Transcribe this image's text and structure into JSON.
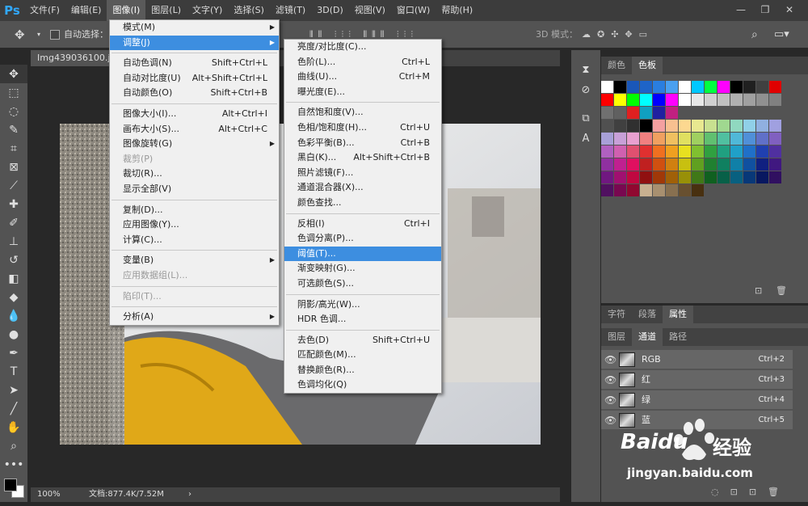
{
  "app": {
    "logo": "Ps"
  },
  "menubar": {
    "items": [
      "文件(F)",
      "编辑(E)",
      "图像(I)",
      "图层(L)",
      "文字(Y)",
      "选择(S)",
      "滤镜(T)",
      "3D(D)",
      "视图(V)",
      "窗口(W)",
      "帮助(H)"
    ],
    "active_index": 2,
    "window_buttons": [
      "—",
      "❐",
      "✕"
    ]
  },
  "options_bar": {
    "auto_select_label": "自动选择：",
    "mode3d_label": "3D 模式："
  },
  "document": {
    "tab_name": "Img439036100.jp",
    "zoom": "100%",
    "doc_info": "文档:877.4K/7.52M"
  },
  "image_menu": {
    "items": [
      {
        "label": "模式(M)",
        "shortcut": "",
        "submenu": true
      },
      {
        "label": "调整(J)",
        "shortcut": "",
        "submenu": true,
        "highlight": true
      },
      {
        "sep": true
      },
      {
        "label": "自动色调(N)",
        "shortcut": "Shift+Ctrl+L"
      },
      {
        "label": "自动对比度(U)",
        "shortcut": "Alt+Shift+Ctrl+L"
      },
      {
        "label": "自动颜色(O)",
        "shortcut": "Shift+Ctrl+B"
      },
      {
        "sep": true
      },
      {
        "label": "图像大小(I)...",
        "shortcut": "Alt+Ctrl+I"
      },
      {
        "label": "画布大小(S)...",
        "shortcut": "Alt+Ctrl+C"
      },
      {
        "label": "图像旋转(G)",
        "shortcut": "",
        "submenu": true
      },
      {
        "label": "裁剪(P)",
        "shortcut": "",
        "disabled": true
      },
      {
        "label": "裁切(R)...",
        "shortcut": ""
      },
      {
        "label": "显示全部(V)",
        "shortcut": ""
      },
      {
        "sep": true
      },
      {
        "label": "复制(D)...",
        "shortcut": ""
      },
      {
        "label": "应用图像(Y)...",
        "shortcut": ""
      },
      {
        "label": "计算(C)...",
        "shortcut": ""
      },
      {
        "sep": true
      },
      {
        "label": "变量(B)",
        "shortcut": "",
        "submenu": true
      },
      {
        "label": "应用数据组(L)...",
        "shortcut": "",
        "disabled": true
      },
      {
        "sep": true
      },
      {
        "label": "陷印(T)...",
        "shortcut": "",
        "disabled": true
      },
      {
        "sep": true
      },
      {
        "label": "分析(A)",
        "shortcut": "",
        "submenu": true
      }
    ]
  },
  "adjust_menu": {
    "items": [
      {
        "label": "亮度/对比度(C)...",
        "shortcut": ""
      },
      {
        "label": "色阶(L)...",
        "shortcut": "Ctrl+L"
      },
      {
        "label": "曲线(U)...",
        "shortcut": "Ctrl+M"
      },
      {
        "label": "曝光度(E)...",
        "shortcut": ""
      },
      {
        "sep": true
      },
      {
        "label": "自然饱和度(V)...",
        "shortcut": ""
      },
      {
        "label": "色相/饱和度(H)...",
        "shortcut": "Ctrl+U"
      },
      {
        "label": "色彩平衡(B)...",
        "shortcut": "Ctrl+B"
      },
      {
        "label": "黑白(K)...",
        "shortcut": "Alt+Shift+Ctrl+B"
      },
      {
        "label": "照片滤镜(F)...",
        "shortcut": ""
      },
      {
        "label": "通道混合器(X)...",
        "shortcut": ""
      },
      {
        "label": "颜色查找...",
        "shortcut": ""
      },
      {
        "sep": true
      },
      {
        "label": "反相(I)",
        "shortcut": "Ctrl+I"
      },
      {
        "label": "色调分离(P)...",
        "shortcut": ""
      },
      {
        "label": "阈值(T)...",
        "shortcut": "",
        "highlight": true
      },
      {
        "label": "渐变映射(G)...",
        "shortcut": ""
      },
      {
        "label": "可选颜色(S)...",
        "shortcut": ""
      },
      {
        "sep": true
      },
      {
        "label": "阴影/高光(W)...",
        "shortcut": ""
      },
      {
        "label": "HDR 色调...",
        "shortcut": ""
      },
      {
        "sep": true
      },
      {
        "label": "去色(D)",
        "shortcut": "Shift+Ctrl+U"
      },
      {
        "label": "匹配颜色(M)...",
        "shortcut": ""
      },
      {
        "label": "替换颜色(R)...",
        "shortcut": ""
      },
      {
        "label": "色调均化(Q)",
        "shortcut": ""
      }
    ]
  },
  "swatch_panel": {
    "tabs": [
      "颜色",
      "色板"
    ],
    "active": 1
  },
  "props_panel": {
    "tabs": [
      "字符",
      "段落",
      "属性"
    ],
    "active": 2
  },
  "channels_panel": {
    "tabs": [
      "图层",
      "通道",
      "路径"
    ],
    "active": 1,
    "channels": [
      {
        "name": "RGB",
        "shortcut": "Ctrl+2"
      },
      {
        "name": "红",
        "shortcut": "Ctrl+3"
      },
      {
        "name": "绿",
        "shortcut": "Ctrl+4"
      },
      {
        "name": "蓝",
        "shortcut": "Ctrl+5"
      }
    ]
  },
  "watermark": {
    "brand": "Baidu",
    "brand_cn": "经验",
    "url": "jingyan.baidu.com"
  },
  "swatch_rows": [
    [
      "#ffffff",
      "#000000",
      "#1a57b8",
      "#1e64c8",
      "#2a7ee0",
      "#4aa0f0",
      "#ffffff",
      "#00c8ff",
      "#00ff40",
      "#ff00ff",
      "#000000",
      "#202020",
      "#404040",
      "#e00000"
    ],
    [
      "#ff0000",
      "#ffff00",
      "#00ff00",
      "#00ffff",
      "#0000ff",
      "#ff00ff",
      "#ffffff",
      "#e8e8e8",
      "#d0d0d0",
      "#c0c0c0",
      "#b0b0b0",
      "#a0a0a0",
      "#909090",
      "#808080"
    ],
    [
      "#707070",
      "#606060",
      "#e02020",
      "#10a0c0",
      "#2020a0",
      "#c02080",
      "",
      "",
      "",
      "",
      "",
      "",
      "",
      ""
    ],
    [
      "#505050",
      "#404040",
      "#303030",
      "#000000",
      "#f4a0a0",
      "#f8c090",
      "#fcd890",
      "#e8e890",
      "#c8e090",
      "#a0d890",
      "#90d8c0",
      "#90d0e8",
      "#90b0e0",
      "#a0a0e0"
    ],
    [
      "#a8a0d8",
      "#c8a0d8",
      "#e8a0d0",
      "#f08080",
      "#f0a060",
      "#f0c060",
      "#e0e060",
      "#a0d060",
      "#60c070",
      "#50c0a0",
      "#50b8d8",
      "#5090d8",
      "#6070c8",
      "#8060c0"
    ],
    [
      "#b060c0",
      "#d060b0",
      "#e05070",
      "#e03030",
      "#f07020",
      "#f0a020",
      "#e8e020",
      "#80c030",
      "#30a040",
      "#20a080",
      "#20a0c8",
      "#2070c8",
      "#2040b0",
      "#5030a0"
    ],
    [
      "#9030a0",
      "#c02090",
      "#e01060",
      "#c02020",
      "#d05010",
      "#d08010",
      "#c8c010",
      "#60a020",
      "#208030",
      "#108060",
      "#1080a8",
      "#1050a0",
      "#102080",
      "#401880"
    ],
    [
      "#701880",
      "#a01070",
      "#c00840",
      "#901010",
      "#a03808",
      "#a06008",
      "#989008",
      "#407818",
      "#106020",
      "#086048",
      "#086080",
      "#083878",
      "#081860",
      "#301060"
    ],
    [
      "#501060",
      "#780850",
      "#900830",
      "#c8b090",
      "#a89070",
      "#887050",
      "#685030",
      "#483010",
      "",
      "",
      "",
      "",
      "",
      ""
    ]
  ]
}
